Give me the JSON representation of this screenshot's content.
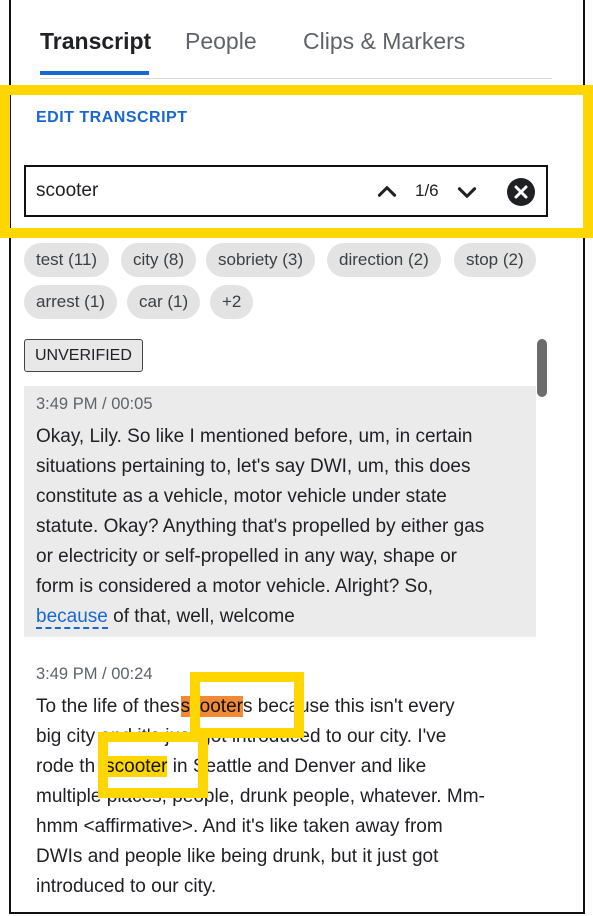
{
  "tabs": [
    {
      "label": "Transcript"
    },
    {
      "label": "People"
    },
    {
      "label": "Clips & Markers"
    }
  ],
  "edit_link": "EDIT TRANSCRIPT",
  "search": {
    "value": "scooter",
    "counter": "1/6"
  },
  "chips": [
    {
      "label": "test (11)"
    },
    {
      "label": "city (8)"
    },
    {
      "label": "sobriety (3)"
    },
    {
      "label": "direction (2)"
    },
    {
      "label": "stop (2)"
    },
    {
      "label": "arrest (1)"
    },
    {
      "label": "car (1)"
    },
    {
      "label": "+2"
    }
  ],
  "badge": "UNVERIFIED",
  "segments": [
    {
      "timestamp": "3:49 PM / 00:05",
      "lines": [
        "Okay, Lily. So like I mentioned before, um, in certain",
        "situations pertaining to, let's say DWI, um, this does",
        "constitute as a vehicle, motor vehicle under state",
        "statute. Okay? Anything that's propelled by either gas",
        "or electricity or self-propelled in any way, shape or",
        "form is considered a motor vehicle. Alright? So,"
      ],
      "last_line": {
        "link": "because",
        "rest": " of that, well, welcome"
      }
    },
    {
      "timestamp": "3:49 PM / 00:24",
      "line1": {
        "pre": "To the life of thes",
        "match": "scooter",
        "post": "s because this isn't every"
      },
      "line2": "big city and it's just got introduced to our city. I've",
      "line3": {
        "pre": "rode th",
        "match": "scooter",
        "post": " in Seattle and Denver and like"
      },
      "lines_rest": [
        "multiple places, people, drunk people, whatever. Mm-",
        "hmm <affirmative>. And it's like taken away from",
        "DWIs and people like being drunk, but it just got",
        "introduced to our city."
      ]
    }
  ],
  "colors": {
    "accent": "#1967d2",
    "highlight": "#ffd600",
    "current_match": "#f08a34"
  }
}
